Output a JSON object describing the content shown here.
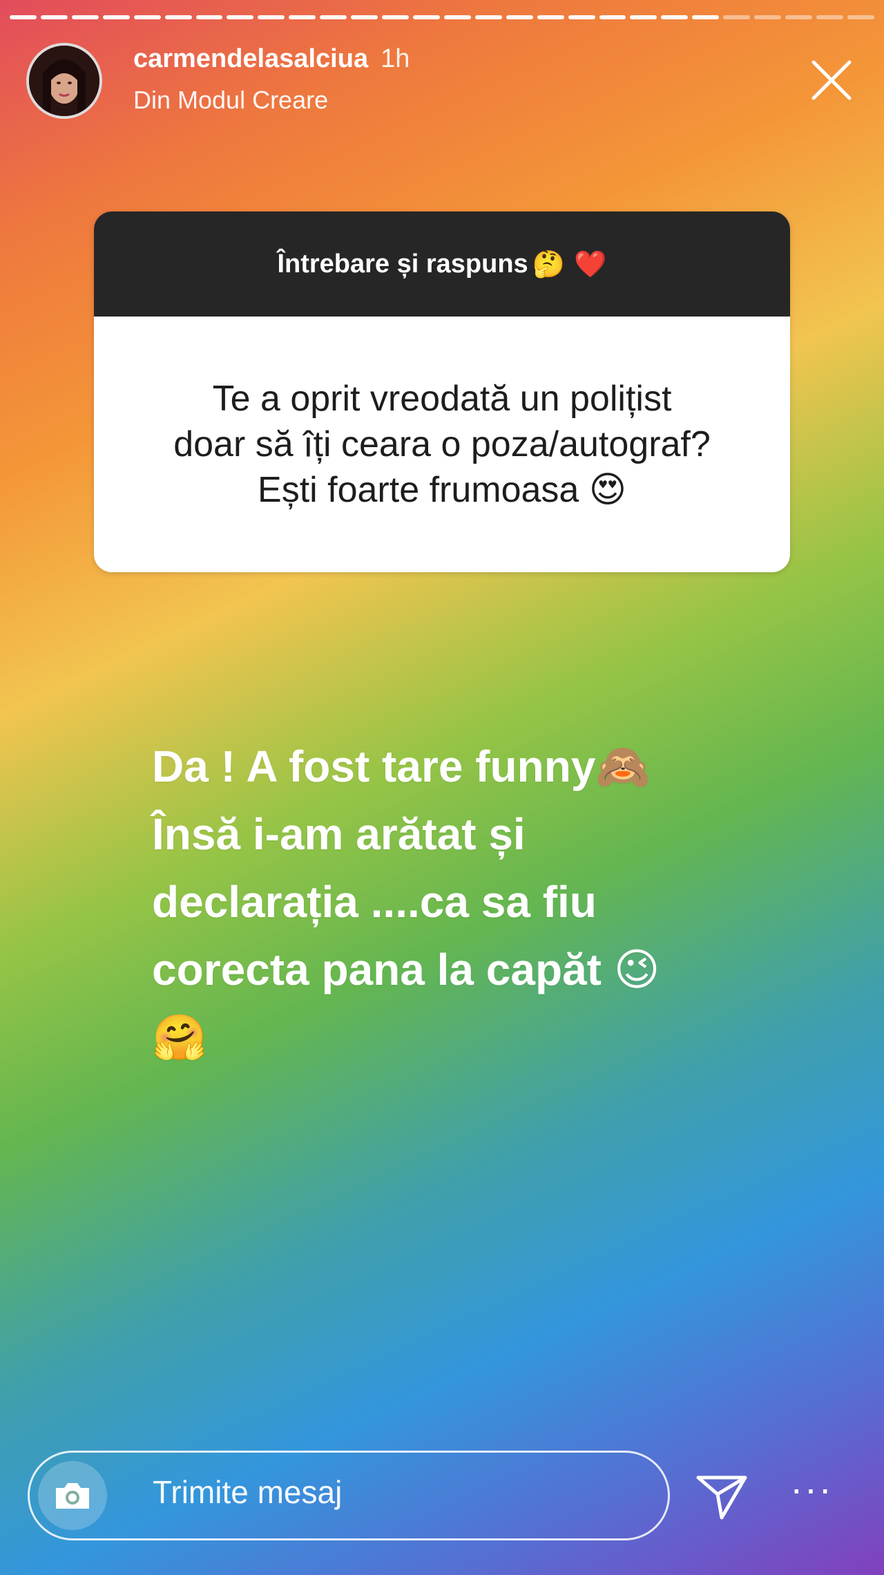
{
  "story": {
    "username": "carmendelasalciua",
    "time": "1h",
    "subtitle": "Din Modul Creare",
    "progress_segments": [
      1,
      1,
      1,
      1,
      1,
      1,
      1,
      1,
      1,
      1,
      1,
      1,
      1,
      1,
      1,
      1,
      1,
      1,
      1,
      1,
      1,
      1,
      1,
      0,
      0,
      0,
      0,
      0
    ]
  },
  "question_box": {
    "header": "Întrebare și raspuns",
    "header_emoji": "🤔 ❤️",
    "lines": [
      "Te a oprit vreodată un polițist",
      "doar să îți ceara o poza/autograf?",
      "Ești foarte frumoasa 😍"
    ]
  },
  "answer": {
    "lines": [
      "Da ! A fost tare funny🙈",
      "Însă i-am arătat și",
      "declarația ....ca sa fiu",
      "corecta pana la capăt 😉",
      "🤗"
    ]
  },
  "footer": {
    "message_placeholder": "Trimite mesaj",
    "more_label": "···"
  },
  "colors": {
    "card_header_bg": "#262626",
    "card_body_bg": "#ffffff",
    "card_text": "#1d1d1d"
  },
  "icons": [
    "close-icon",
    "camera-icon",
    "send-icon",
    "more-icon"
  ]
}
